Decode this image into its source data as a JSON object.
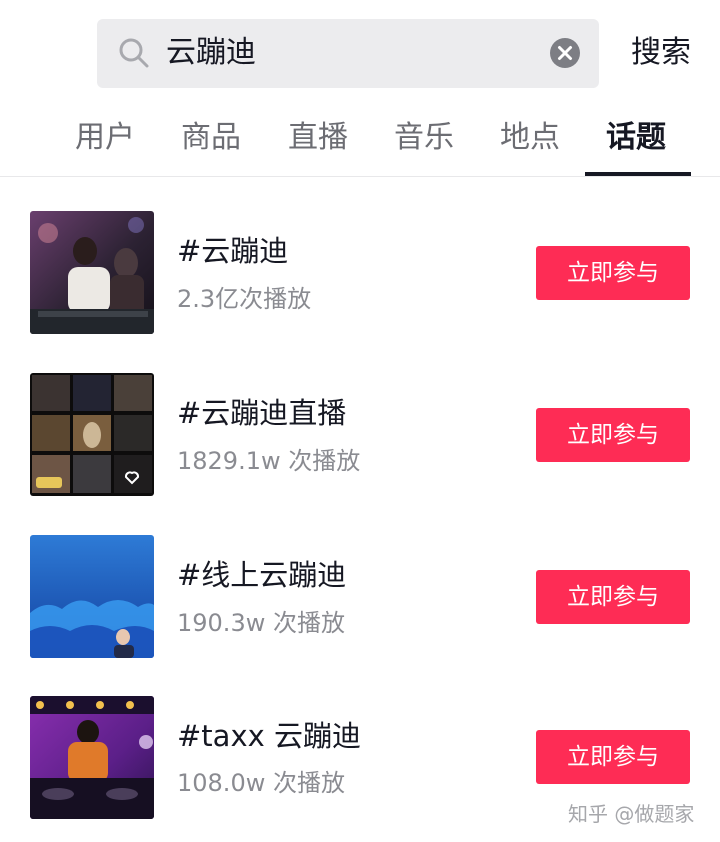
{
  "search": {
    "query": "云蹦迪",
    "submit_label": "搜索"
  },
  "tabs": [
    {
      "label": "用户",
      "active": false
    },
    {
      "label": "商品",
      "active": false
    },
    {
      "label": "直播",
      "active": false
    },
    {
      "label": "音乐",
      "active": false
    },
    {
      "label": "地点",
      "active": false
    },
    {
      "label": "话题",
      "active": true
    }
  ],
  "topics": [
    {
      "title": "#云蹦迪",
      "plays": "2.3亿次播放",
      "action": "立即参与"
    },
    {
      "title": "#云蹦迪直播",
      "plays": "1829.1w 次播放",
      "action": "立即参与"
    },
    {
      "title": "#线上云蹦迪",
      "plays": "190.3w 次播放",
      "action": "立即参与"
    },
    {
      "title": "#taxx 云蹦迪",
      "plays": "108.0w 次播放",
      "action": "立即参与"
    }
  ],
  "watermark": "知乎 @做题家",
  "colors": {
    "accent": "#fe2c55",
    "text": "#161823",
    "muted": "#8a8b91",
    "search_bg": "#ececee"
  }
}
